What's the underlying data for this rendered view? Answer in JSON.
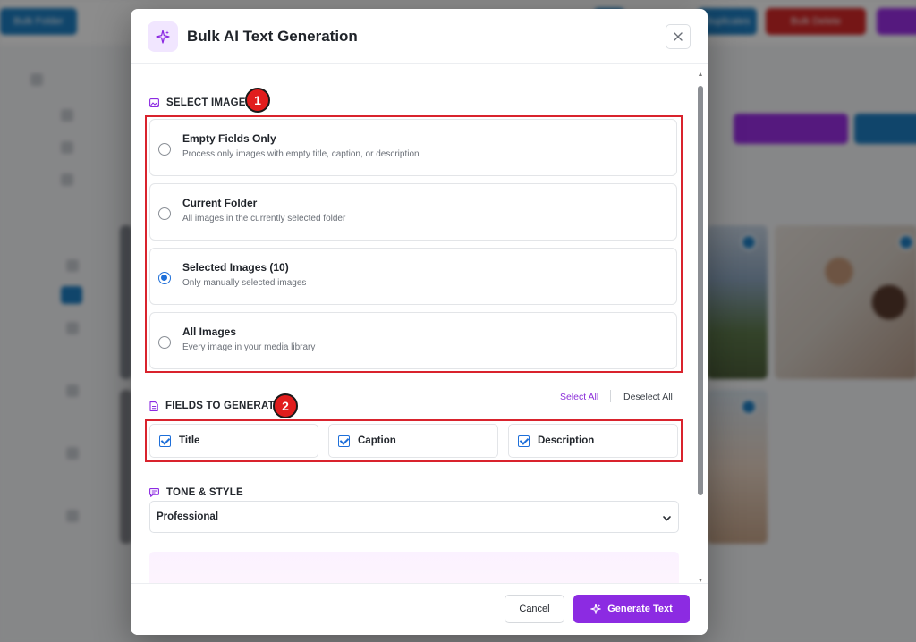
{
  "background": {
    "top_buttons": [
      "Bulk Folder",
      "",
      "Duplicates",
      "Bulk Delete",
      ""
    ],
    "note": ""
  },
  "modal": {
    "title": "Bulk AI Text Generation",
    "icons": {
      "header": "sparkle-icon",
      "close": "close-icon"
    },
    "select_images": {
      "label": "SELECT IMAGES",
      "step": "1",
      "icon": "image-icon",
      "options": [
        {
          "title": "Empty Fields Only",
          "desc": "Process only images with empty title, caption, or description",
          "checked": false
        },
        {
          "title": "Current Folder",
          "desc": "All images in the currently selected folder",
          "checked": false
        },
        {
          "title": "Selected Images (10)",
          "desc": "Only manually selected images",
          "checked": true
        },
        {
          "title": "All Images",
          "desc": "Every image in your media library",
          "checked": false
        }
      ]
    },
    "fields": {
      "label": "FIELDS TO GENERATE",
      "step": "2",
      "icon": "document-icon",
      "select_all": "Select All",
      "deselect_all": "Deselect All",
      "items": [
        {
          "label": "Title",
          "checked": true
        },
        {
          "label": "Caption",
          "checked": true
        },
        {
          "label": "Description",
          "checked": true
        }
      ]
    },
    "tone": {
      "label": "TONE & STYLE",
      "icon": "chat-icon",
      "value": "Professional"
    },
    "footer": {
      "cancel": "Cancel",
      "generate": "Generate Text"
    }
  },
  "colors": {
    "accent": "#8c2be2",
    "radio_checked": "#1e6fd9",
    "annotation_red": "#d9232d"
  }
}
